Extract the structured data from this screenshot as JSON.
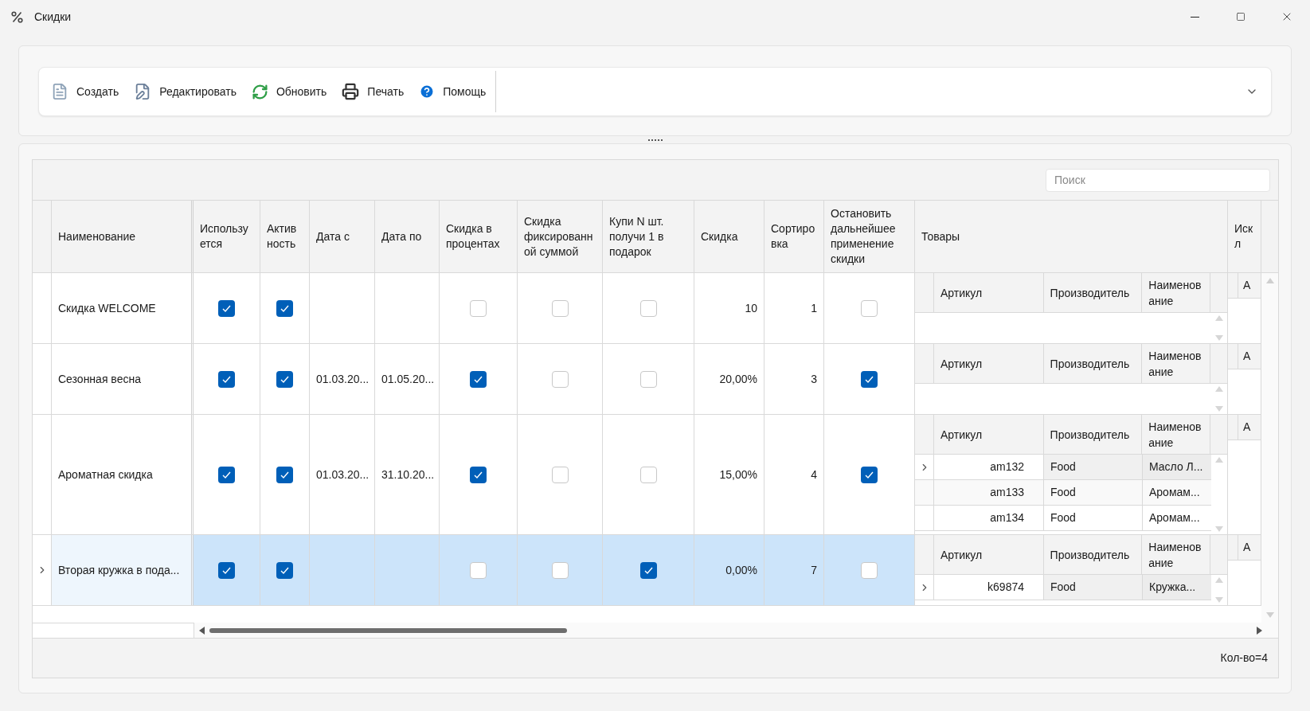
{
  "window": {
    "title": "Скидки"
  },
  "toolbar": {
    "buttons": [
      {
        "label": "Создать"
      },
      {
        "label": "Редактировать"
      },
      {
        "label": "Обновить"
      },
      {
        "label": "Печать"
      },
      {
        "label": "Помощь"
      }
    ]
  },
  "search": {
    "placeholder": "Поиск"
  },
  "table": {
    "columns": [
      {
        "label": "Наименование",
        "kind": "text"
      },
      {
        "label": "Используется",
        "kind": "check"
      },
      {
        "label": "Активность",
        "kind": "check"
      },
      {
        "label": "Дата с",
        "kind": "text"
      },
      {
        "label": "Дата по",
        "kind": "text"
      },
      {
        "label": "Скидка в процентах",
        "kind": "check"
      },
      {
        "label": "Скидка фиксированной суммой",
        "kind": "check"
      },
      {
        "label": "Купи N шт. получи 1 в подарок",
        "kind": "check"
      },
      {
        "label": "Скидка",
        "kind": "number"
      },
      {
        "label": "Сортировка",
        "kind": "number"
      },
      {
        "label": "Остановить дальнейшее применение скидки",
        "kind": "check"
      },
      {
        "label": "Товары",
        "kind": "goods"
      },
      {
        "label": "Искл",
        "kind": "exclusions"
      }
    ],
    "rows": [
      {
        "selected": false,
        "cells": [
          "Скидка WELCOME",
          {
            "checked": true
          },
          {
            "checked": true
          },
          null,
          null,
          {
            "checked": false
          },
          {
            "checked": false
          },
          {
            "checked": false
          },
          "10",
          "1",
          {
            "checked": false
          },
          {
            "columns": [
              "Артикул",
              "Производитель",
              "Наименование"
            ]
          },
          {
            "columns": [
              "А"
            ]
          }
        ]
      },
      {
        "selected": false,
        "cells": [
          "Сезонная весна",
          {
            "checked": true
          },
          {
            "checked": true
          },
          "01.03.20...",
          "01.05.20...",
          {
            "checked": true
          },
          {
            "checked": false
          },
          {
            "checked": false
          },
          "20,00%",
          "3",
          {
            "checked": true
          },
          {
            "columns": [
              "Артикул",
              "Производитель",
              "Наименование"
            ]
          },
          {
            "columns": [
              "А"
            ]
          }
        ]
      },
      {
        "selected": false,
        "cells": [
          "Ароматная скидка",
          {
            "checked": true
          },
          {
            "checked": true
          },
          "01.03.20...",
          "31.10.20...",
          {
            "checked": true
          },
          {
            "checked": false
          },
          {
            "checked": false
          },
          "15,00%",
          "4",
          {
            "checked": true
          },
          {
            "columns": [
              "Артикул",
              "Производитель",
              "Наименование"
            ],
            "items": [
              {
                "article": "am132",
                "maker": "Food",
                "name": "Масло Л...",
                "selected": true
              },
              {
                "article": "am133",
                "maker": "Food",
                "name": "Аромам...",
                "selected": false
              },
              {
                "article": "am134",
                "maker": "Food",
                "name": "Аромам...",
                "selected": false
              }
            ]
          },
          {
            "columns": [
              "А"
            ]
          }
        ]
      },
      {
        "selected": true,
        "cells": [
          "Вторая кружка в пода...",
          {
            "checked": true
          },
          {
            "checked": true
          },
          null,
          null,
          {
            "checked": false
          },
          {
            "checked": false
          },
          {
            "checked": true
          },
          "0,00%",
          "7",
          {
            "checked": false
          },
          {
            "columns": [
              "Артикул",
              "Производитель",
              "Наименование"
            ],
            "items": [
              {
                "article": "k69874",
                "maker": "Food",
                "name": "Кружка...",
                "selected": true
              }
            ]
          },
          {
            "columns": [
              "А"
            ]
          }
        ]
      }
    ]
  },
  "status": {
    "count": "Кол-во=4"
  }
}
